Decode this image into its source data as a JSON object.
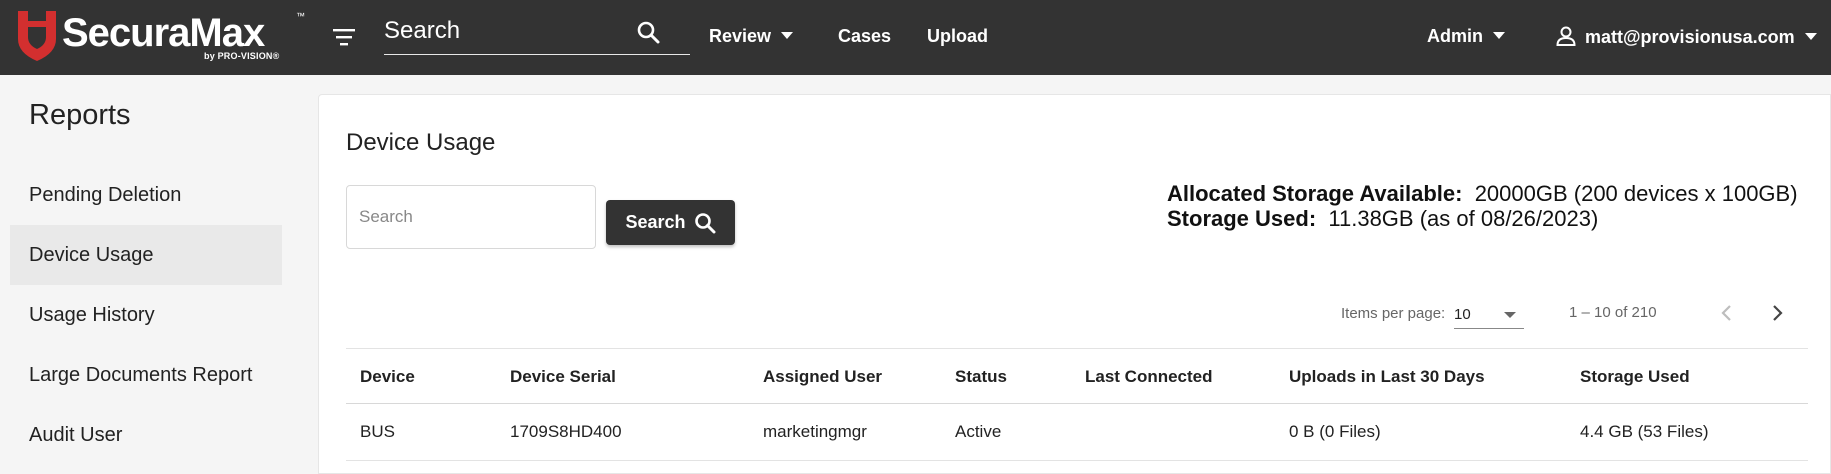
{
  "header": {
    "logo_text": "SecuraMax",
    "logo_tm": "™",
    "logo_sub": "by PRO-VISION®",
    "search_placeholder": "Search",
    "nav": {
      "review": "Review",
      "cases": "Cases",
      "upload": "Upload",
      "admin": "Admin",
      "user": "matt@provisionusa.com"
    }
  },
  "sidebar": {
    "title": "Reports",
    "items": [
      {
        "label": "Pending Deletion"
      },
      {
        "label": "Device Usage"
      },
      {
        "label": "Usage History"
      },
      {
        "label": "Large Documents Report"
      },
      {
        "label": "Audit User"
      }
    ],
    "active_index": 1
  },
  "main": {
    "title": "Device Usage",
    "filter_placeholder": "Search",
    "search_button": "Search",
    "storage": {
      "allocated_label": "Allocated Storage Available:",
      "allocated_value": "20000GB (200 devices x 100GB)",
      "used_label": "Storage Used:",
      "used_value": "11.38GB (as of 08/26/2023)"
    },
    "paginator": {
      "items_label": "Items per page:",
      "page_size": "10",
      "range": "1 – 10 of 210"
    },
    "table": {
      "columns": [
        "Device",
        "Device Serial",
        "Assigned User",
        "Status",
        "Last Connected",
        "Uploads in Last 30 Days",
        "Storage Used"
      ],
      "rows": [
        [
          "BUS",
          "1709S8HD400",
          "marketingmgr",
          "Active",
          "",
          "0 B (0 Files)",
          "4.4 GB (53 Files)"
        ]
      ]
    }
  },
  "colors": {
    "topbar": "#333333",
    "brand_red": "#d32f2f",
    "button_dark": "#333333"
  }
}
